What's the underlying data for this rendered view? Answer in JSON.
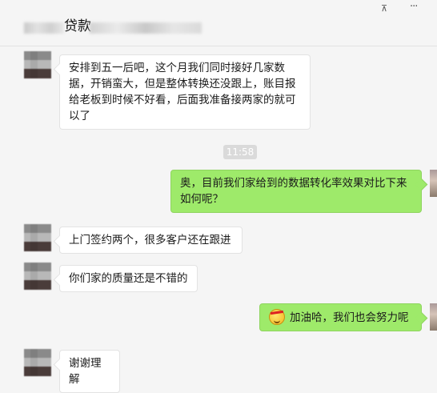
{
  "header": {
    "title": "贷款",
    "pin_icon": "pin-icon",
    "more_icon": "more-icon"
  },
  "messages": [
    {
      "side": "left",
      "text": "安排到五一后吧，这个月我们同时接好几家数据，开销蛮大，但是整体转换还没跟上，账目报给老板到时候不好看，后面我准备接两家的就可以了"
    },
    {
      "side": "time",
      "text": "11:58"
    },
    {
      "side": "right",
      "text": "奥，目前我们家给到的数据转化率效果对比下来如何呢？"
    },
    {
      "side": "left",
      "text": "上门签约两个，很多客户还在跟进"
    },
    {
      "side": "left",
      "text": "你们家的质量还是不错的"
    },
    {
      "side": "right",
      "text": "加油哈，我们也会努力呢",
      "emoji": "fighting-emoji"
    },
    {
      "side": "left",
      "text": "谢谢理解"
    }
  ],
  "colors": {
    "background": "#f5f5f5",
    "sent_bubble": "#9eea6a",
    "received_bubble": "#ffffff",
    "timestamp_bg": "#dadada"
  }
}
